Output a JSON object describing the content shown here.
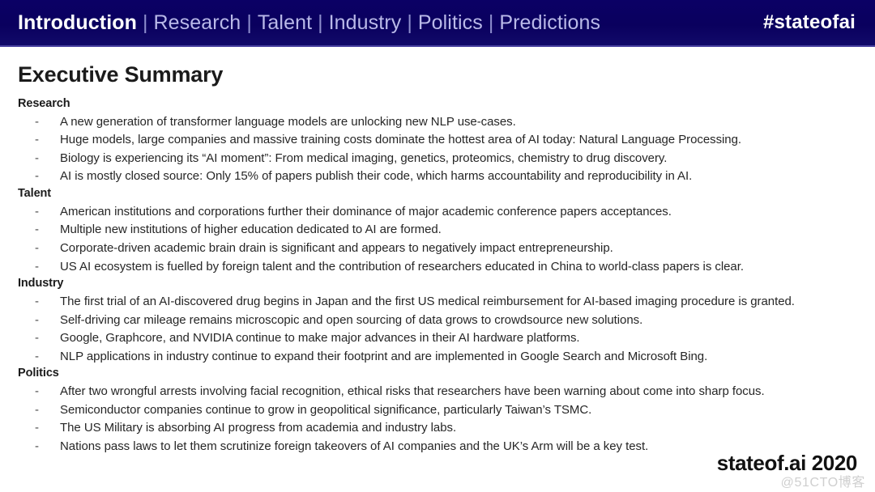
{
  "navbar": {
    "items": [
      {
        "label": "Introduction",
        "active": true
      },
      {
        "label": "Research",
        "active": false
      },
      {
        "label": "Talent",
        "active": false
      },
      {
        "label": "Industry",
        "active": false
      },
      {
        "label": "Politics",
        "active": false
      },
      {
        "label": "Predictions",
        "active": false
      }
    ],
    "separator": "|",
    "hashtag": "#stateofai",
    "background_color": "#0b0065",
    "active_color": "#ffffff",
    "inactive_color": "#b9b9e8"
  },
  "main": {
    "title": "Executive Summary",
    "sections": [
      {
        "heading": "Research",
        "bullets": [
          "A new generation of transformer language models are unlocking new NLP use-cases.",
          "Huge models, large companies and massive training costs dominate the hottest area of AI today: Natural Language Processing.",
          "Biology is experiencing its “AI moment”: From medical imaging, genetics, proteomics, chemistry to drug discovery.",
          "AI is mostly closed source: Only 15% of papers publish their code, which harms accountability and reproducibility in AI."
        ]
      },
      {
        "heading": "Talent",
        "bullets": [
          "American institutions and corporations further their dominance of major academic conference papers acceptances.",
          "Multiple new institutions of higher education dedicated to AI are formed.",
          "Corporate-driven academic brain drain is significant and appears to negatively impact entrepreneurship.",
          "US AI ecosystem is fuelled by foreign talent and the contribution of researchers educated in China to world-class papers is clear."
        ]
      },
      {
        "heading": "Industry",
        "bullets": [
          "The first trial of an AI-discovered drug begins in Japan and the first US medical reimbursement for AI-based imaging procedure is granted.",
          "Self-driving car mileage remains microscopic and open sourcing of data grows to crowdsource new solutions.",
          "Google, Graphcore, and NVIDIA continue to make major advances in their AI hardware platforms.",
          "NLP applications in industry continue to expand their footprint and are implemented in Google Search and Microsoft Bing."
        ]
      },
      {
        "heading": "Politics",
        "bullets": [
          "After two wrongful arrests involving facial recognition, ethical risks that researchers have been warning about come into sharp focus.",
          "Semiconductor companies continue to grow in geopolitical significance, particularly Taiwan’s TSMC.",
          "The US Military is absorbing AI progress from academia and industry labs.",
          "Nations pass laws to let them scrutinize foreign takeovers of AI companies and the UK’s Arm will be a key test."
        ]
      }
    ],
    "bullet_dash": "-"
  },
  "footer": {
    "brand": "stateof.ai 2020",
    "watermark": "@51CTO博客"
  }
}
